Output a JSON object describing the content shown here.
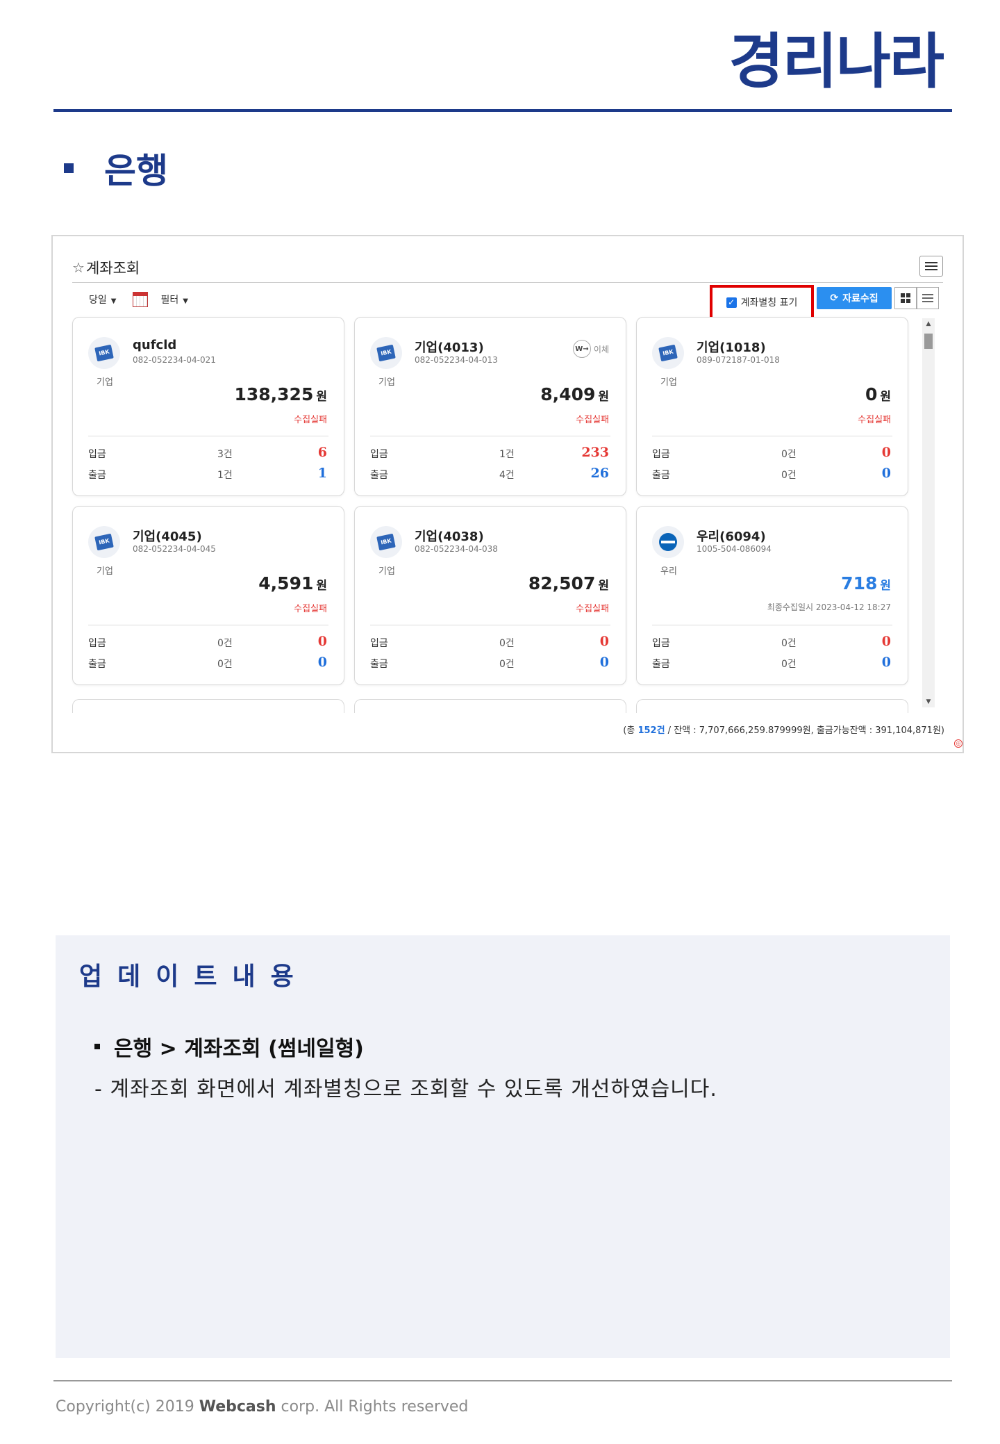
{
  "brand": {
    "logo_text": "경리나라"
  },
  "section": {
    "title": "은행"
  },
  "screen": {
    "title": "계좌조회",
    "toolbar": {
      "period": "당일",
      "filter": "필터"
    },
    "alias_toggle": {
      "label": "계좌별칭 표기",
      "checked": true
    },
    "collect_button": "자료수집",
    "cards": [
      {
        "icon": "ibk-logo-icon",
        "name": "qufcld",
        "account_no": "082-052234-04-021",
        "bank": "기업",
        "balance": "138,325",
        "currency": "원",
        "status": "수집실패",
        "deposit_label": "입금",
        "deposit_count": "3건",
        "deposit_amount": "6",
        "withdraw_label": "출금",
        "withdraw_count": "1건",
        "withdraw_amount": "1"
      },
      {
        "icon": "ibk-logo-icon",
        "name": "기업(4013)",
        "account_no": "082-052234-04-013",
        "bank": "기업",
        "transfer": "이체",
        "balance": "8,409",
        "currency": "원",
        "status": "수집실패",
        "deposit_label": "입금",
        "deposit_count": "1건",
        "deposit_amount": "233",
        "withdraw_label": "출금",
        "withdraw_count": "4건",
        "withdraw_amount": "26"
      },
      {
        "icon": "ibk-logo-icon",
        "name": "기업(1018)",
        "account_no": "089-072187-01-018",
        "bank": "기업",
        "balance": "0",
        "currency": "원",
        "status": "수집실패",
        "deposit_label": "입금",
        "deposit_count": "0건",
        "deposit_amount": "0",
        "withdraw_label": "출금",
        "withdraw_count": "0건",
        "withdraw_amount": "0"
      },
      {
        "icon": "ibk-logo-icon",
        "name": "기업(4045)",
        "account_no": "082-052234-04-045",
        "bank": "기업",
        "balance": "4,591",
        "currency": "원",
        "status": "수집실패",
        "deposit_label": "입금",
        "deposit_count": "0건",
        "deposit_amount": "0",
        "withdraw_label": "출금",
        "withdraw_count": "0건",
        "withdraw_amount": "0"
      },
      {
        "icon": "ibk-logo-icon",
        "name": "기업(4038)",
        "account_no": "082-052234-04-038",
        "bank": "기업",
        "balance": "82,507",
        "currency": "원",
        "status": "수집실패",
        "deposit_label": "입금",
        "deposit_count": "0건",
        "deposit_amount": "0",
        "withdraw_label": "출금",
        "withdraw_count": "0건",
        "withdraw_amount": "0"
      },
      {
        "icon": "woori-logo-icon",
        "name": "우리(6094)",
        "account_no": "1005-504-086094",
        "bank": "우리",
        "balance": "718",
        "currency": "원",
        "status": "최종수집일시 2023-04-12 18:27",
        "deposit_label": "입금",
        "deposit_count": "0건",
        "deposit_amount": "0",
        "withdraw_label": "출금",
        "withdraw_count": "0건",
        "withdraw_amount": "0"
      }
    ],
    "summary": {
      "prefix": "(총 ",
      "count": "152건",
      "rest": " / 잔액 : 7,707,666,259.879999원, 출금가능잔액 : 391,104,871원)"
    }
  },
  "update": {
    "title": "업데이트내용",
    "item": "은행 > 계좌조회 (썸네일형)",
    "description": "- 계좌조회 화면에서 계좌별칭으로 조회할 수 있도록 개선하였습니다."
  },
  "footer": {
    "pre": "Copyright(c) 2019 ",
    "company": "Webcash",
    "post": " corp. All Rights reserved"
  },
  "colors": {
    "brand_navy": "#1d3a8a",
    "highlight_red": "#e00000",
    "button_blue": "#2b8ff0",
    "deposit_red": "#e53935",
    "withdraw_blue": "#1f6fdb"
  }
}
